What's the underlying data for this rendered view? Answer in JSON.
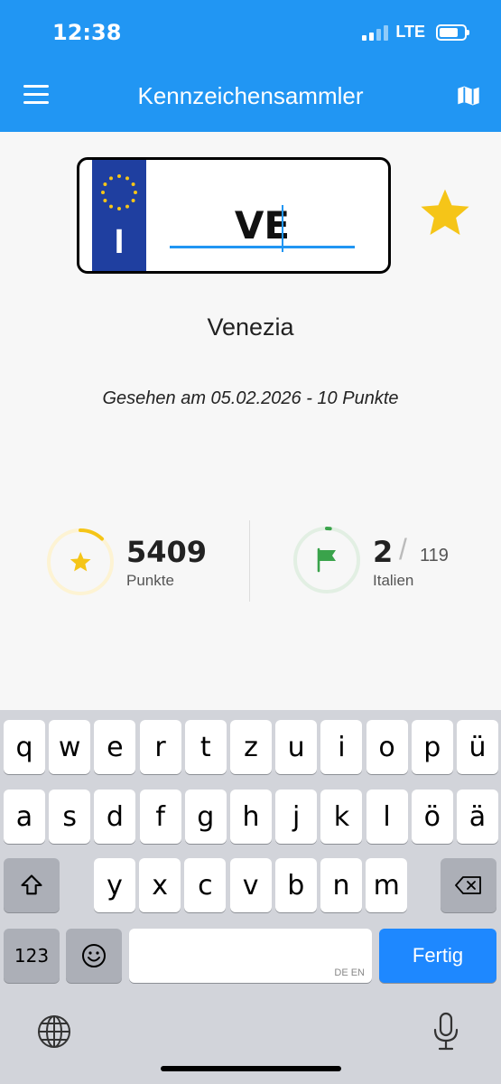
{
  "status_bar": {
    "time": "12:38",
    "network": "LTE"
  },
  "app_bar": {
    "title": "Kennzeichensammler",
    "menu_icon": "hamburger-menu-icon",
    "map_icon": "map-icon"
  },
  "plate": {
    "country_code": "I",
    "input_value": "VE",
    "favorite_icon": "star-icon"
  },
  "details": {
    "city": "Venezia",
    "seen_text": "Gesehen am 05.02.2026 - 10 Punkte"
  },
  "stats": {
    "points": {
      "value": "5409",
      "label": "Punkte",
      "progress": 0.12
    },
    "country": {
      "value": "2",
      "total": "119",
      "label": "Italien",
      "progress": 0.017
    }
  },
  "colors": {
    "primary": "#2196f3",
    "gold": "#f5c518",
    "green": "#3aa34b"
  },
  "keyboard": {
    "row1": [
      "q",
      "w",
      "e",
      "r",
      "t",
      "z",
      "u",
      "i",
      "o",
      "p",
      "ü"
    ],
    "row2": [
      "a",
      "s",
      "d",
      "f",
      "g",
      "h",
      "j",
      "k",
      "l",
      "ö",
      "ä"
    ],
    "row3": [
      "y",
      "x",
      "c",
      "v",
      "b",
      "n",
      "m"
    ],
    "numbers_key": "123",
    "space_lang": "DE EN",
    "done_key": "Fertig"
  }
}
